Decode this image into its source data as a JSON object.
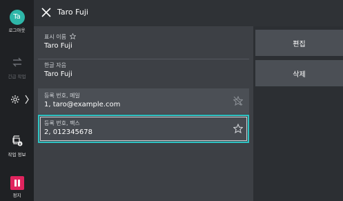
{
  "sidebar": {
    "avatar_initials": "Ta",
    "logout_label": "로그아웃",
    "transfer_label": "긴급 작업",
    "job_info_label": "작업 정보",
    "stop_label": "정지"
  },
  "header": {
    "title": "Taro Fuji"
  },
  "fields": [
    {
      "label": "표시 이름",
      "value": "Taro Fuji"
    },
    {
      "label": "한글 자음",
      "value": "Taro Fuji"
    },
    {
      "label": "등록 번호, 메일",
      "value": "1, taro@example.com"
    },
    {
      "label": "등록 번호, 팩스",
      "value": "2, 012345678"
    }
  ],
  "actions": {
    "edit_label": "편집",
    "delete_label": "삭제"
  },
  "colors": {
    "accent_teal": "#2ec4c4",
    "avatar": "#2eb6a8",
    "stop_red": "#e0245e"
  }
}
